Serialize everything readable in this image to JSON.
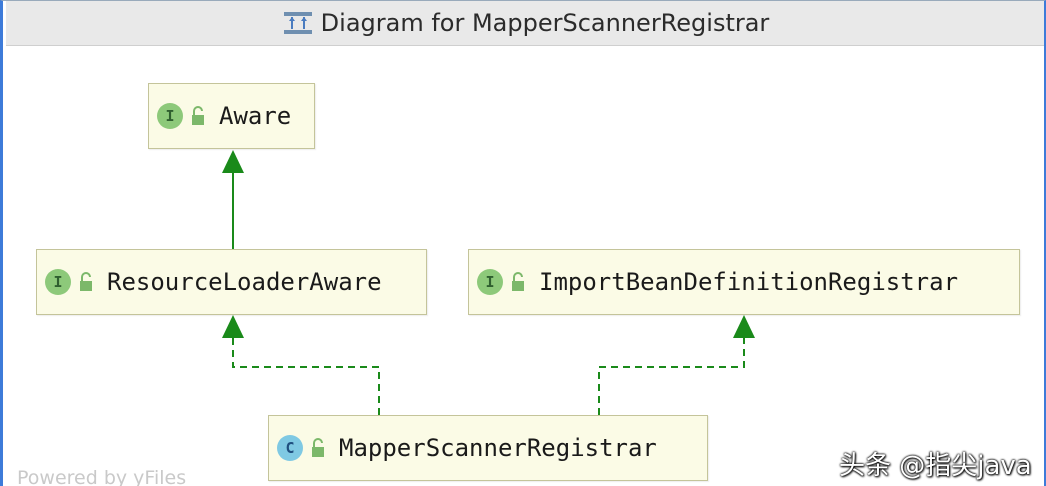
{
  "window": {
    "title": "Diagram for MapperScannerRegistrar",
    "title_icon": "class-diagram-icon"
  },
  "nodes": [
    {
      "id": "aware",
      "label": "Aware",
      "kind": "interface",
      "badge": "I"
    },
    {
      "id": "resource_loader_aware",
      "label": "ResourceLoaderAware",
      "kind": "interface",
      "badge": "I"
    },
    {
      "id": "import_bean_definition_registrar",
      "label": "ImportBeanDefinitionRegistrar",
      "kind": "interface",
      "badge": "I"
    },
    {
      "id": "mapper_scanner_registrar",
      "label": "MapperScannerRegistrar",
      "kind": "class",
      "badge": "C"
    }
  ],
  "edges": [
    {
      "from": "resource_loader_aware",
      "to": "aware",
      "style": "solid",
      "relation": "extends"
    },
    {
      "from": "mapper_scanner_registrar",
      "to": "resource_loader_aware",
      "style": "dashed",
      "relation": "implements"
    },
    {
      "from": "mapper_scanner_registrar",
      "to": "import_bean_definition_registrar",
      "style": "dashed",
      "relation": "implements"
    }
  ],
  "colors": {
    "node_fill": "#fbfbe6",
    "node_border": "#c4c49a",
    "edge": "#1a8a1a",
    "interface_badge": "#8dc97a",
    "class_badge": "#7fc9e3",
    "window_border": "#3d7bd9"
  },
  "footer": "Powered by yFiles",
  "watermark": "头条 @指尖java"
}
